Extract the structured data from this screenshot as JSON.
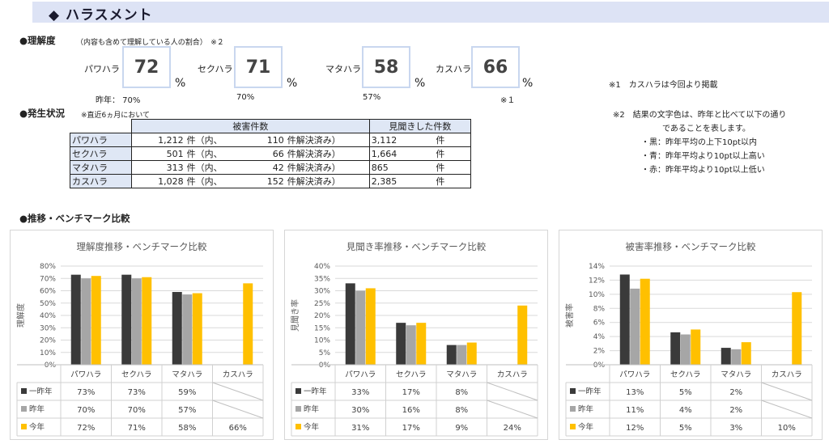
{
  "header": {
    "title": "◆ ハラスメント"
  },
  "understanding": {
    "label": "●理解度",
    "sub": "（内容も含めて理解している人の割合）　※２",
    "items": [
      {
        "name": "パワハラ",
        "value": "72",
        "prev": "昨年：  70%"
      },
      {
        "name": "セクハラ",
        "value": "71",
        "prev": "70%"
      },
      {
        "name": "マタハラ",
        "value": "58",
        "prev": "57%"
      },
      {
        "name": "カスハラ",
        "value": "66",
        "prev": "※１"
      }
    ],
    "unit": "%"
  },
  "notes": {
    "note1": "※1　カスハラは今回より掲載",
    "note2_lines": [
      "※2　結果の文字色は、昨年と比べて以下の通り",
      "であることを表します。",
      "・黒：昨年平均の上下10pt以内",
      "・青：昨年平均より10pt以上高い",
      "・赤：昨年平均より10pt以上低い"
    ]
  },
  "occurrence": {
    "label": "●発生状況",
    "sub": "※直近6ヵ月において",
    "headers": [
      "被害件数",
      "見聞きした件数"
    ],
    "rows": [
      {
        "name": "パワハラ",
        "victims": "1,212",
        "unit": "件（内、",
        "resolved": "110",
        "resolved_label": "件解決済み）",
        "witnessed": "3,112",
        "wunit": "件"
      },
      {
        "name": "セクハラ",
        "victims": "501",
        "unit": "件（内、",
        "resolved": "66",
        "resolved_label": "件解決済み）",
        "witnessed": "1,664",
        "wunit": "件"
      },
      {
        "name": "マタハラ",
        "victims": "313",
        "unit": "件（内、",
        "resolved": "42",
        "resolved_label": "件解決済み）",
        "witnessed": "865",
        "wunit": "件"
      },
      {
        "name": "カスハラ",
        "victims": "1,028",
        "unit": "件（内、",
        "resolved": "152",
        "resolved_label": "件解決済み）",
        "witnessed": "2,385",
        "wunit": "件"
      }
    ]
  },
  "trend": {
    "label": "●推移・ベンチマーク比較"
  },
  "chart_data": [
    {
      "type": "bar",
      "title": "理解度推移・ベンチマーク比較",
      "ylabel": "理解度",
      "categories": [
        "パワハラ",
        "セクハラ",
        "マタハラ",
        "カスハラ"
      ],
      "ylim": [
        0,
        80
      ],
      "yticks": [
        "0%",
        "10%",
        "20%",
        "30%",
        "40%",
        "50%",
        "60%",
        "70%",
        "80%"
      ],
      "series": [
        {
          "name": "一昨年",
          "color": "#3a3a3a",
          "values": [
            73,
            73,
            59,
            null
          ],
          "labels": [
            "73%",
            "73%",
            "59%",
            ""
          ]
        },
        {
          "name": "昨年",
          "color": "#a6a6a6",
          "values": [
            70,
            70,
            57,
            null
          ],
          "labels": [
            "70%",
            "70%",
            "57%",
            ""
          ]
        },
        {
          "name": "今年",
          "color": "#ffc000",
          "values": [
            72,
            71,
            58,
            66
          ],
          "labels": [
            "72%",
            "71%",
            "58%",
            "66%"
          ]
        }
      ]
    },
    {
      "type": "bar",
      "title": "見聞き率推移・ベンチマーク比較",
      "ylabel": "見聞き率",
      "categories": [
        "パワハラ",
        "セクハラ",
        "マタハラ",
        "カスハラ"
      ],
      "ylim": [
        0,
        40
      ],
      "yticks": [
        "0%",
        "5%",
        "10%",
        "15%",
        "20%",
        "25%",
        "30%",
        "35%",
        "40%"
      ],
      "series": [
        {
          "name": "一昨年",
          "color": "#3a3a3a",
          "values": [
            33,
            17,
            8,
            null
          ],
          "labels": [
            "33%",
            "17%",
            "8%",
            ""
          ]
        },
        {
          "name": "昨年",
          "color": "#a6a6a6",
          "values": [
            30,
            16,
            8,
            null
          ],
          "labels": [
            "30%",
            "16%",
            "8%",
            ""
          ]
        },
        {
          "name": "今年",
          "color": "#ffc000",
          "values": [
            31,
            17,
            9,
            24
          ],
          "labels": [
            "31%",
            "17%",
            "9%",
            "24%"
          ]
        }
      ]
    },
    {
      "type": "bar",
      "title": "被害率推移・ベンチマーク比較",
      "ylabel": "被害率",
      "categories": [
        "パワハラ",
        "セクハラ",
        "マタハラ",
        "カスハラ"
      ],
      "ylim": [
        0,
        14
      ],
      "yticks": [
        "0%",
        "2%",
        "4%",
        "6%",
        "8%",
        "10%",
        "12%",
        "14%"
      ],
      "series": [
        {
          "name": "一昨年",
          "color": "#3a3a3a",
          "values": [
            12.8,
            4.6,
            2.4,
            null
          ],
          "labels": [
            "13%",
            "5%",
            "2%",
            ""
          ]
        },
        {
          "name": "昨年",
          "color": "#a6a6a6",
          "values": [
            10.8,
            4.3,
            2.2,
            null
          ],
          "labels": [
            "11%",
            "4%",
            "2%",
            ""
          ]
        },
        {
          "name": "今年",
          "color": "#ffc000",
          "values": [
            12.2,
            5.0,
            3.2,
            10.3
          ],
          "labels": [
            "12%",
            "5%",
            "3%",
            "10%"
          ]
        }
      ]
    }
  ]
}
